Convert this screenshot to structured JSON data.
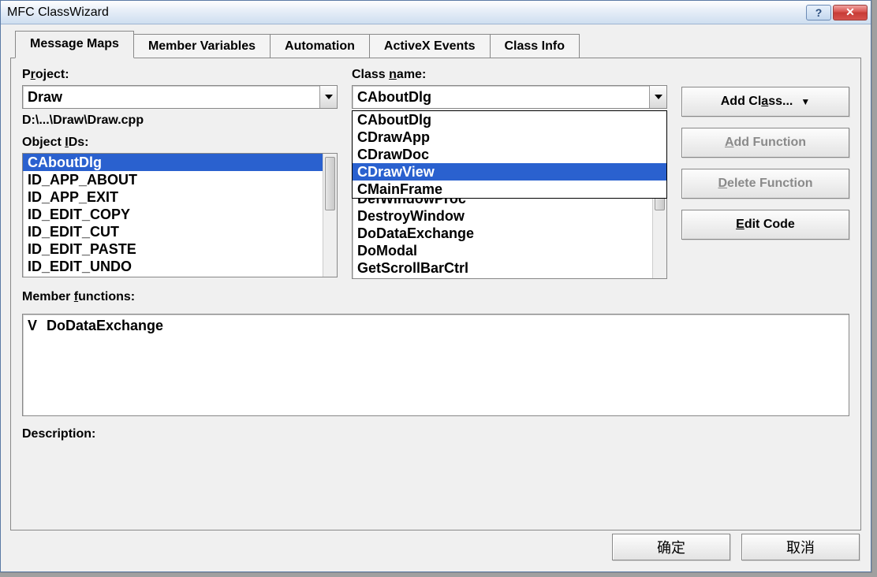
{
  "window": {
    "title": "MFC ClassWizard"
  },
  "tabs": {
    "items": [
      {
        "label": "Message Maps"
      },
      {
        "label": "Member Variables"
      },
      {
        "label": "Automation"
      },
      {
        "label": "ActiveX Events"
      },
      {
        "label": "Class Info"
      }
    ],
    "active_index": 0
  },
  "labels": {
    "project_pre": "P",
    "project_u": "r",
    "project_post": "oject:",
    "classname_pre": "Class ",
    "classname_u": "n",
    "classname_post": "ame:",
    "objectids_pre": "Object ",
    "objectids_u": "I",
    "objectids_post": "Ds:",
    "memfun_pre": "Member ",
    "memfun_u": "f",
    "memfun_post": "unctions:",
    "description": "Description:"
  },
  "project_combo": {
    "value": "Draw"
  },
  "path_line": "D:\\...\\Draw\\Draw.cpp",
  "classname_combo": {
    "value": "CAboutDlg"
  },
  "classname_dropdown": {
    "items": [
      "CAboutDlg",
      "CDrawApp",
      "CDrawDoc",
      "CDrawView",
      "CMainFrame"
    ],
    "selected_index": 3
  },
  "object_ids": {
    "items": [
      "CAboutDlg",
      "ID_APP_ABOUT",
      "ID_APP_EXIT",
      "ID_EDIT_COPY",
      "ID_EDIT_CUT",
      "ID_EDIT_PASTE",
      "ID_EDIT_UNDO"
    ],
    "selected_index": 0
  },
  "messages": {
    "items": [
      "DefWindowProc",
      "DestroyWindow",
      "DoDataExchange",
      "DoModal",
      "GetScrollBarCtrl"
    ]
  },
  "side_buttons": {
    "add_class_pre": "Add Cl",
    "add_class_u": "a",
    "add_class_post": "ss...",
    "add_function_pre": "",
    "add_function_u": "A",
    "add_function_post": "dd Function",
    "delete_function_pre": "",
    "delete_function_u": "D",
    "delete_function_post": "elete Function",
    "edit_code_pre": "",
    "edit_code_u": "E",
    "edit_code_post": "dit Code"
  },
  "member_functions": {
    "rows": [
      {
        "marker": "V",
        "name": "DoDataExchange"
      }
    ]
  },
  "dialog_buttons": {
    "ok": "确定",
    "cancel": "取消"
  }
}
